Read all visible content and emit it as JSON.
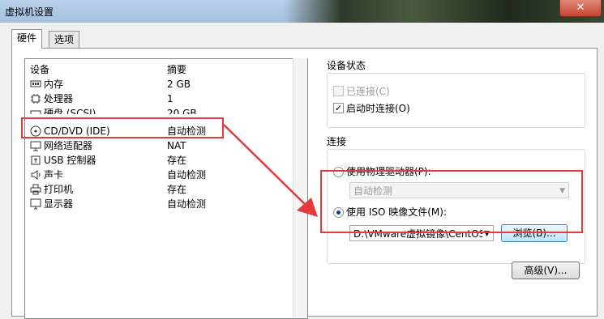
{
  "window": {
    "title": "虚拟机设置",
    "close_label": "✕"
  },
  "tabs": [
    {
      "label": "硬件"
    },
    {
      "label": "选项"
    }
  ],
  "device_list": {
    "headers": {
      "device": "设备",
      "summary": "摘要"
    },
    "rows": [
      {
        "name": "内存",
        "summary": "2 GB",
        "icon": "memory-icon"
      },
      {
        "name": "处理器",
        "summary": "1",
        "icon": "processor-icon"
      },
      {
        "name": "硬盘 (SCSI)",
        "summary": "20 GB",
        "icon": "hard-disk-icon"
      },
      {
        "name": "CD/DVD (IDE)",
        "summary": "自动检测",
        "icon": "cd-dvd-icon"
      },
      {
        "name": "网络适配器",
        "summary": "NAT",
        "icon": "network-adapter-icon"
      },
      {
        "name": "USB 控制器",
        "summary": "存在",
        "icon": "usb-icon"
      },
      {
        "name": "声卡",
        "summary": "自动检测",
        "icon": "speaker-icon"
      },
      {
        "name": "打印机",
        "summary": "存在",
        "icon": "printer-icon"
      },
      {
        "name": "显示器",
        "summary": "自动检测",
        "icon": "monitor-icon"
      }
    ]
  },
  "device_status": {
    "title": "设备状态",
    "connected": {
      "label": "已连接(C)",
      "checked": false,
      "enabled": false
    },
    "connect_at_power_on": {
      "label": "启动时连接(O)",
      "checked": true,
      "mark": "✓"
    }
  },
  "connection": {
    "title": "连接",
    "physical_drive": {
      "label": "使用物理驱动器(P):",
      "selected": false
    },
    "physical_drive_combo": {
      "value": "自动检测",
      "enabled": false
    },
    "iso": {
      "label": "使用 ISO 映像文件(M):",
      "selected": true
    },
    "iso_path": "D:\\VMware虚拟镜像\\CentOS",
    "browse_label": "浏览(B)...",
    "advanced_label": "高级(V)..."
  },
  "colors": {
    "annotation": "#e33b3b",
    "selection_dot": "#1d3c8f"
  }
}
